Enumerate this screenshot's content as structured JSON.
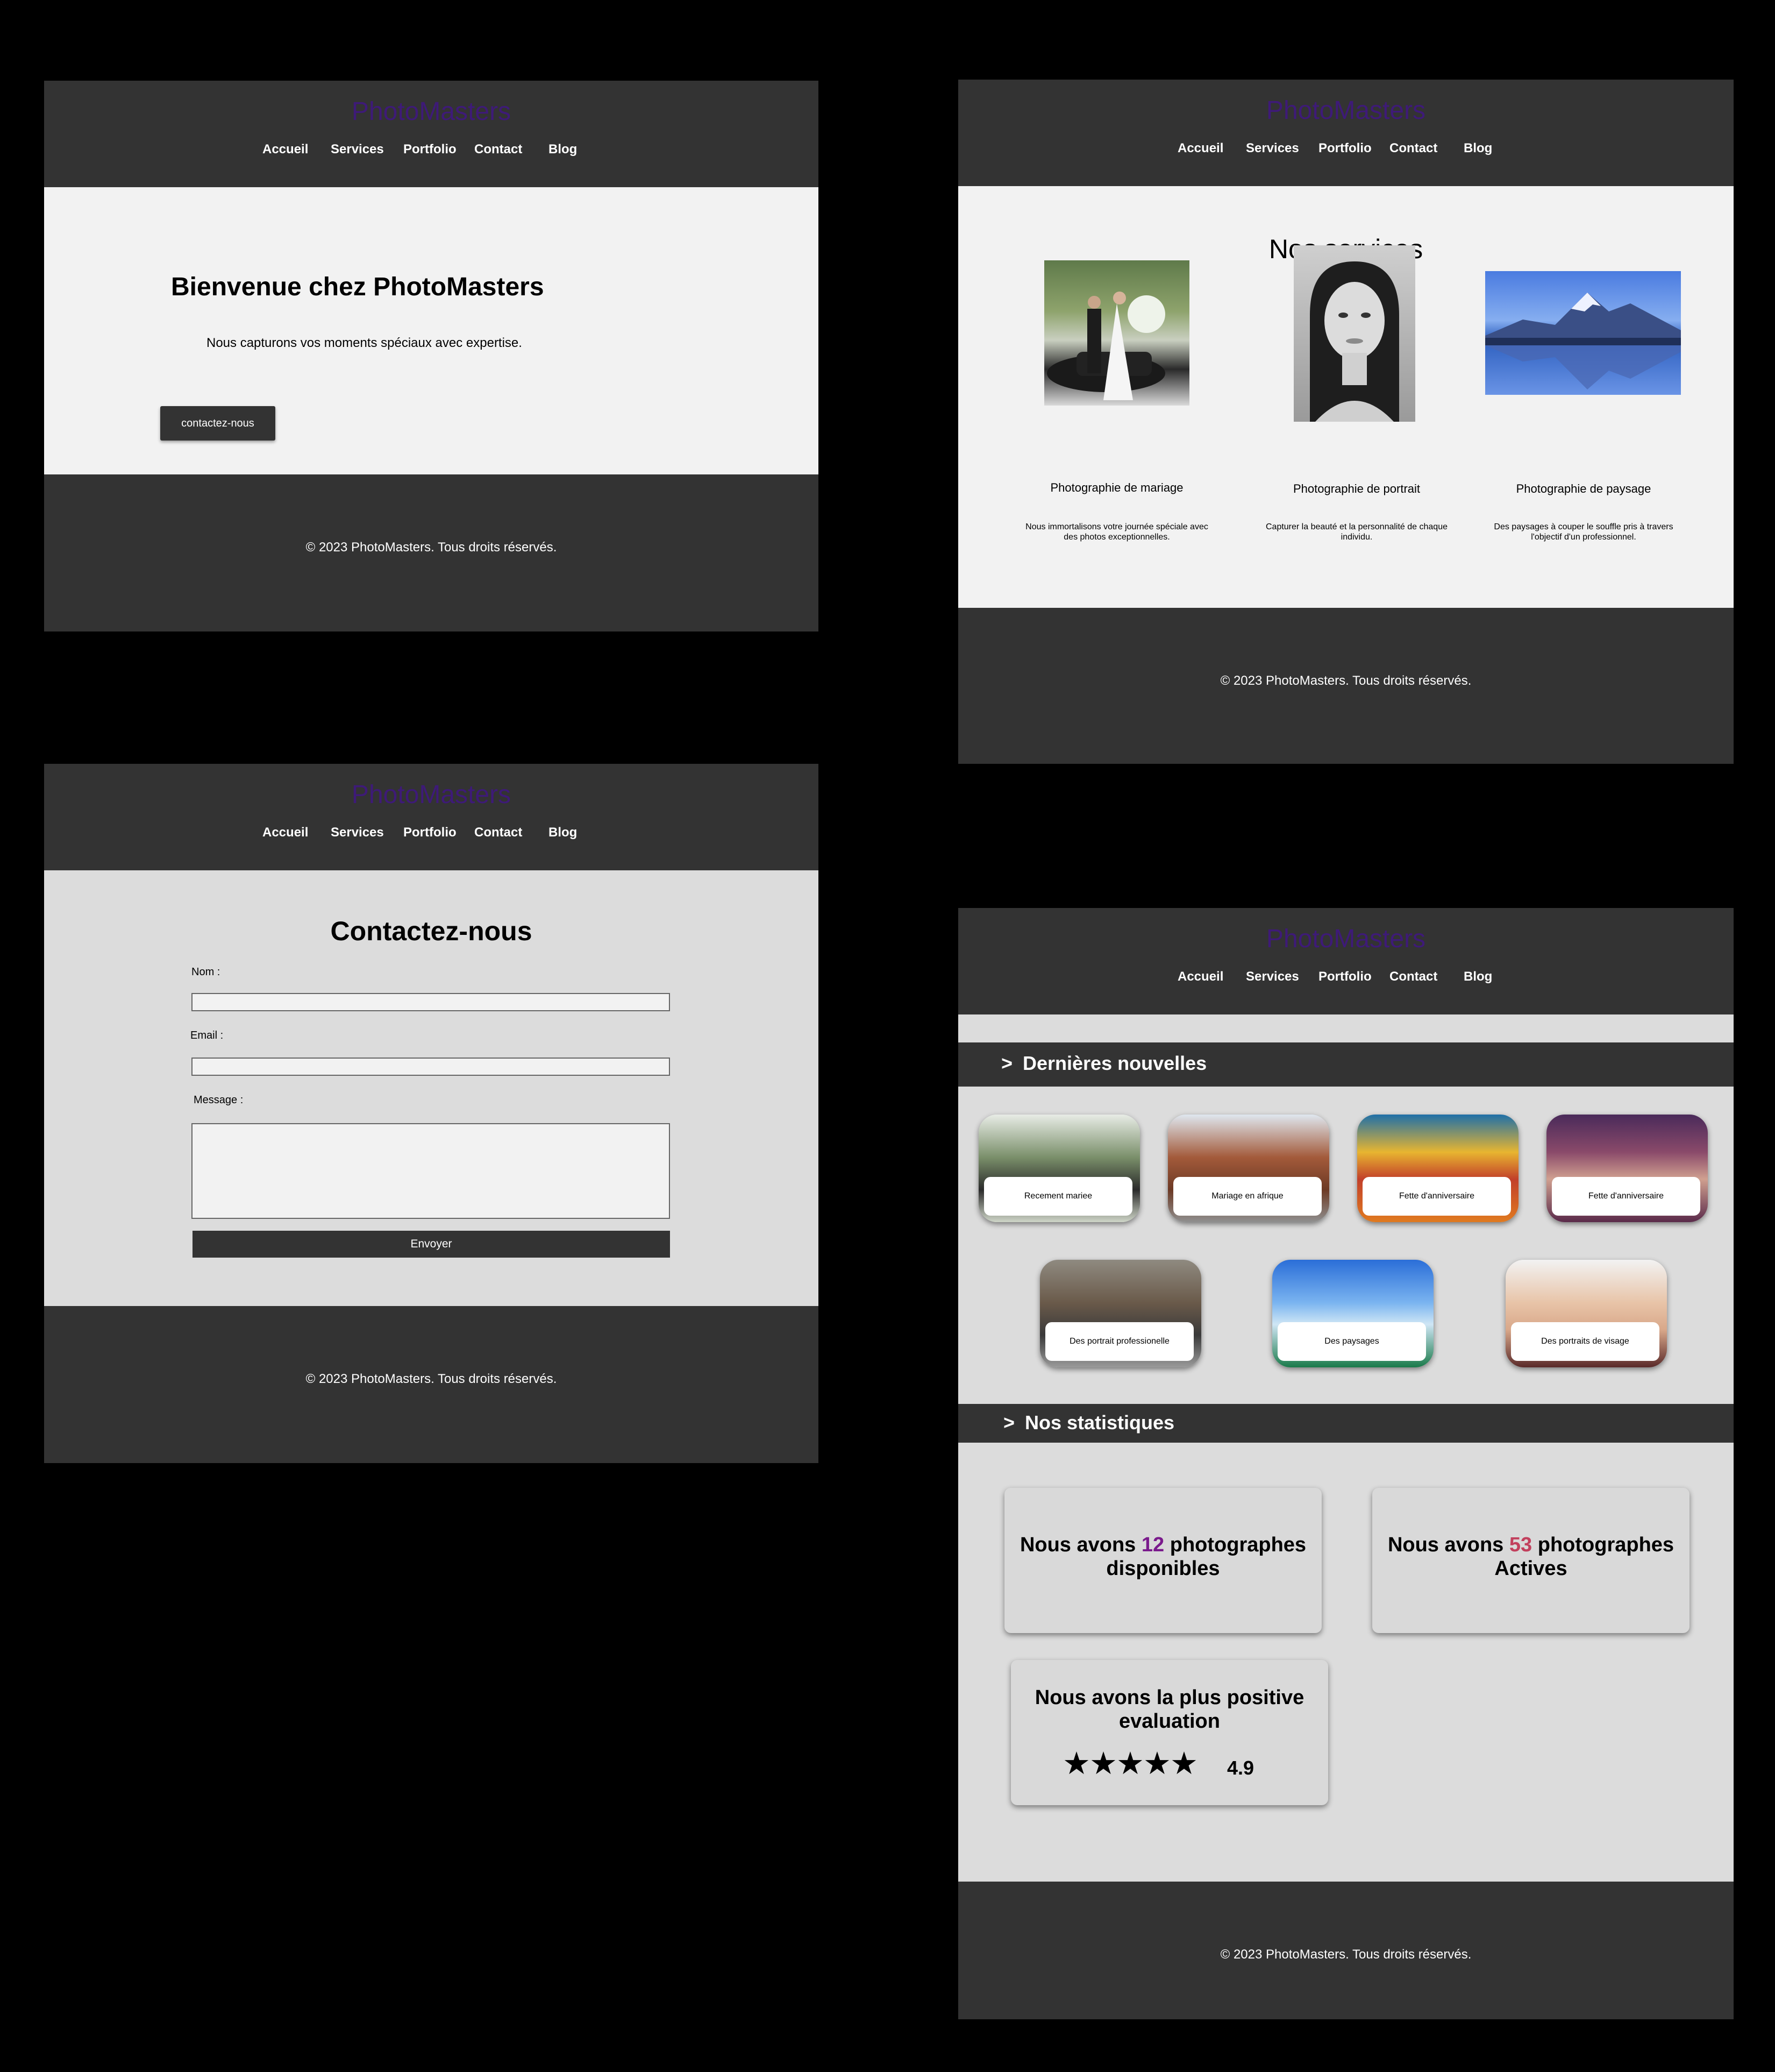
{
  "site": {
    "brand": "PhotoMasters",
    "nav": [
      "Accueil",
      "Services",
      "Portfolio",
      "Contact",
      "Blog"
    ],
    "copyright": "© 2023 PhotoMasters. Tous droits réservés.",
    "brand_color": "#3e1a78",
    "header_color": "#333333"
  },
  "home": {
    "title": "Bienvenue chez PhotoMasters",
    "subtitle": "Nous capturons vos moments spéciaux avec expertise.",
    "cta": "contactez-nous"
  },
  "services": {
    "title": "Nos services",
    "items": [
      {
        "title": "Photographie de mariage",
        "desc": "Nous immortalisons votre journée spéciale avec des photos exceptionnelles."
      },
      {
        "title": "Photographie de portrait",
        "desc": "Capturer la beauté et la personnalité de chaque individu."
      },
      {
        "title": "Photographie de paysage",
        "desc": "Des paysages à couper le souffle pris à travers l'objectif d'un professionnel."
      }
    ]
  },
  "contact": {
    "title": "Contactez-nous",
    "name_label": "Nom :",
    "email_label": "Email :",
    "message_label": "Message :",
    "submit": "Envoyer"
  },
  "blog": {
    "news_title": "Dernières nouvelles",
    "news_prefix": ">",
    "news": [
      {
        "caption": "Recement mariee"
      },
      {
        "caption": "Mariage en afrique"
      },
      {
        "caption": "Fette d'anniversaire"
      },
      {
        "caption": "Fette d'anniversaire"
      },
      {
        "caption": "Des portrait professionelle"
      },
      {
        "caption": "Des paysages"
      },
      {
        "caption": "Des portraits de visage"
      }
    ],
    "stats_title": "Nos statistiques",
    "stats_prefix": ">",
    "stats": {
      "s1_pre": "Nous avons ",
      "s1_num": "12",
      "s1_post": " photographes disponibles",
      "s2_pre": "Nous avons ",
      "s2_num": "53",
      "s2_post": " photographes Actives",
      "s3_text": "Nous avons la plus positive evaluation",
      "s3_stars": "★★★★★",
      "s3_rating": "4.9"
    }
  }
}
